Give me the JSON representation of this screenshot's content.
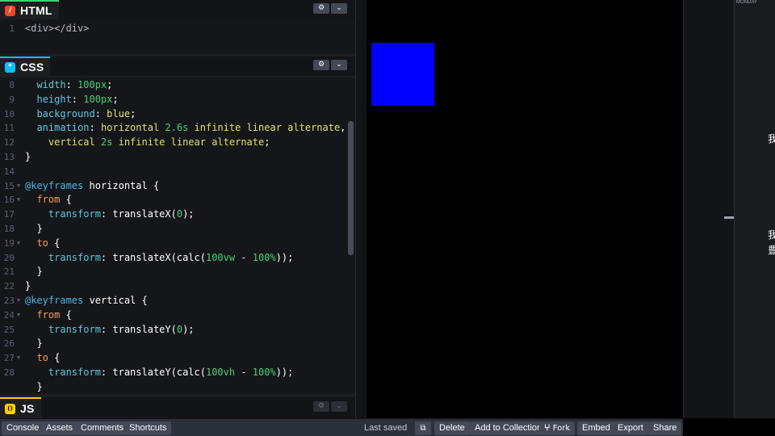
{
  "html_panel": {
    "label": "HTML",
    "icon": "html-logo-icon",
    "icon_glyph": "/",
    "color": "#e34c26",
    "settings_glyph": "⚙",
    "collapse_glyph": "⌄",
    "lines": [
      {
        "n": "1",
        "tokens": [
          {
            "t": "<div></div>",
            "c": "t-tag"
          }
        ]
      }
    ]
  },
  "css_panel": {
    "label": "CSS",
    "icon": "css-logo-icon",
    "icon_glyph": "*",
    "color": "#0ebeff",
    "settings_glyph": "⚙",
    "collapse_glyph": "⌄",
    "lines": [
      {
        "n": "8",
        "tokens": [
          {
            "t": "  width",
            "c": "t-prop"
          },
          {
            "t": ": ",
            "c": "t-fn"
          },
          {
            "t": "100px",
            "c": "t-num"
          },
          {
            "t": ";",
            "c": "t-fn"
          }
        ]
      },
      {
        "n": "9",
        "tokens": [
          {
            "t": "  height",
            "c": "t-prop"
          },
          {
            "t": ": ",
            "c": "t-fn"
          },
          {
            "t": "100px",
            "c": "t-num"
          },
          {
            "t": ";",
            "c": "t-fn"
          }
        ]
      },
      {
        "n": "10",
        "tokens": [
          {
            "t": "  background",
            "c": "t-prop"
          },
          {
            "t": ": ",
            "c": "t-fn"
          },
          {
            "t": "blue",
            "c": "t-val"
          },
          {
            "t": ";",
            "c": "t-fn"
          }
        ]
      },
      {
        "n": "11",
        "tokens": [
          {
            "t": "  animation",
            "c": "t-prop"
          },
          {
            "t": ": ",
            "c": "t-fn"
          },
          {
            "t": "horizontal ",
            "c": "t-val"
          },
          {
            "t": "2.6s",
            "c": "t-num"
          },
          {
            "t": " infinite linear alternate",
            "c": "t-val"
          },
          {
            "t": ",",
            "c": "t-fn"
          }
        ]
      },
      {
        "n": "12",
        "tokens": [
          {
            "t": "    vertical ",
            "c": "t-val"
          },
          {
            "t": "2s",
            "c": "t-num"
          },
          {
            "t": " infinite linear alternate",
            "c": "t-val"
          },
          {
            "t": ";",
            "c": "t-fn"
          }
        ]
      },
      {
        "n": "13",
        "tokens": [
          {
            "t": "}",
            "c": "t-fn"
          }
        ]
      },
      {
        "n": "14",
        "tokens": []
      },
      {
        "n": "15",
        "fold": true,
        "tokens": [
          {
            "t": "@keyframes",
            "c": "t-kw"
          },
          {
            "t": " horizontal {",
            "c": "t-fn"
          }
        ]
      },
      {
        "n": "16",
        "fold": true,
        "tokens": [
          {
            "t": "  from",
            "c": "t-sel"
          },
          {
            "t": " {",
            "c": "t-fn"
          }
        ]
      },
      {
        "n": "17",
        "tokens": [
          {
            "t": "    transform",
            "c": "t-prop"
          },
          {
            "t": ": translateX(",
            "c": "t-fn"
          },
          {
            "t": "0",
            "c": "t-num"
          },
          {
            "t": ");",
            "c": "t-fn"
          }
        ]
      },
      {
        "n": "18",
        "tokens": [
          {
            "t": "  }",
            "c": "t-fn"
          }
        ]
      },
      {
        "n": "19",
        "fold": true,
        "tokens": [
          {
            "t": "  to",
            "c": "t-sel"
          },
          {
            "t": " {",
            "c": "t-fn"
          }
        ]
      },
      {
        "n": "20",
        "tokens": [
          {
            "t": "    transform",
            "c": "t-prop"
          },
          {
            "t": ": translateX(calc(",
            "c": "t-fn"
          },
          {
            "t": "100vw",
            "c": "t-num"
          },
          {
            "t": " - ",
            "c": "t-fn"
          },
          {
            "t": "100%",
            "c": "t-num"
          },
          {
            "t": "));",
            "c": "t-fn"
          }
        ]
      },
      {
        "n": "21",
        "tokens": [
          {
            "t": "  }",
            "c": "t-fn"
          }
        ]
      },
      {
        "n": "22",
        "tokens": [
          {
            "t": "}",
            "c": "t-fn"
          }
        ]
      },
      {
        "n": "23",
        "fold": true,
        "tokens": [
          {
            "t": "@keyframes",
            "c": "t-kw"
          },
          {
            "t": " vertical {",
            "c": "t-fn"
          }
        ]
      },
      {
        "n": "24",
        "fold": true,
        "tokens": [
          {
            "t": "  from",
            "c": "t-sel"
          },
          {
            "t": " {",
            "c": "t-fn"
          }
        ]
      },
      {
        "n": "25",
        "tokens": [
          {
            "t": "    transform",
            "c": "t-prop"
          },
          {
            "t": ": translateY(",
            "c": "t-fn"
          },
          {
            "t": "0",
            "c": "t-num"
          },
          {
            "t": ");",
            "c": "t-fn"
          }
        ]
      },
      {
        "n": "26",
        "tokens": [
          {
            "t": "  }",
            "c": "t-fn"
          }
        ]
      },
      {
        "n": "27",
        "fold": true,
        "tokens": [
          {
            "t": "  to",
            "c": "t-sel"
          },
          {
            "t": " {",
            "c": "t-fn"
          }
        ]
      },
      {
        "n": "28",
        "tokens": [
          {
            "t": "    transform",
            "c": "t-prop"
          },
          {
            "t": ": translateY(calc(",
            "c": "t-fn"
          },
          {
            "t": "100vh",
            "c": "t-num"
          },
          {
            "t": " - ",
            "c": "t-fn"
          },
          {
            "t": "100%",
            "c": "t-num"
          },
          {
            "t": "));",
            "c": "t-fn"
          }
        ]
      },
      {
        "n": "",
        "tokens": [
          {
            "t": "  }",
            "c": "t-fn"
          }
        ]
      }
    ]
  },
  "js_panel": {
    "label": "JS",
    "icon": "js-logo-icon",
    "icon_glyph": "()",
    "color": "#fcd000",
    "settings_glyph": "⚙",
    "collapse_glyph": "⌄"
  },
  "preview": {
    "box_color": "blue"
  },
  "right_strip": {
    "title": "MONDAY",
    "cjk_1": "我",
    "cjk_2": "我",
    "cjk_3": "豊"
  },
  "footer": {
    "left_buttons": [
      "Console",
      "Assets",
      "Comments",
      "Shortcuts"
    ],
    "last_saved": "Last saved",
    "external_glyph": "⧉",
    "right_buttons": [
      "Delete",
      "Add to Collection",
      "ⵖ Fork",
      "Embed",
      "Export",
      "Share"
    ]
  }
}
